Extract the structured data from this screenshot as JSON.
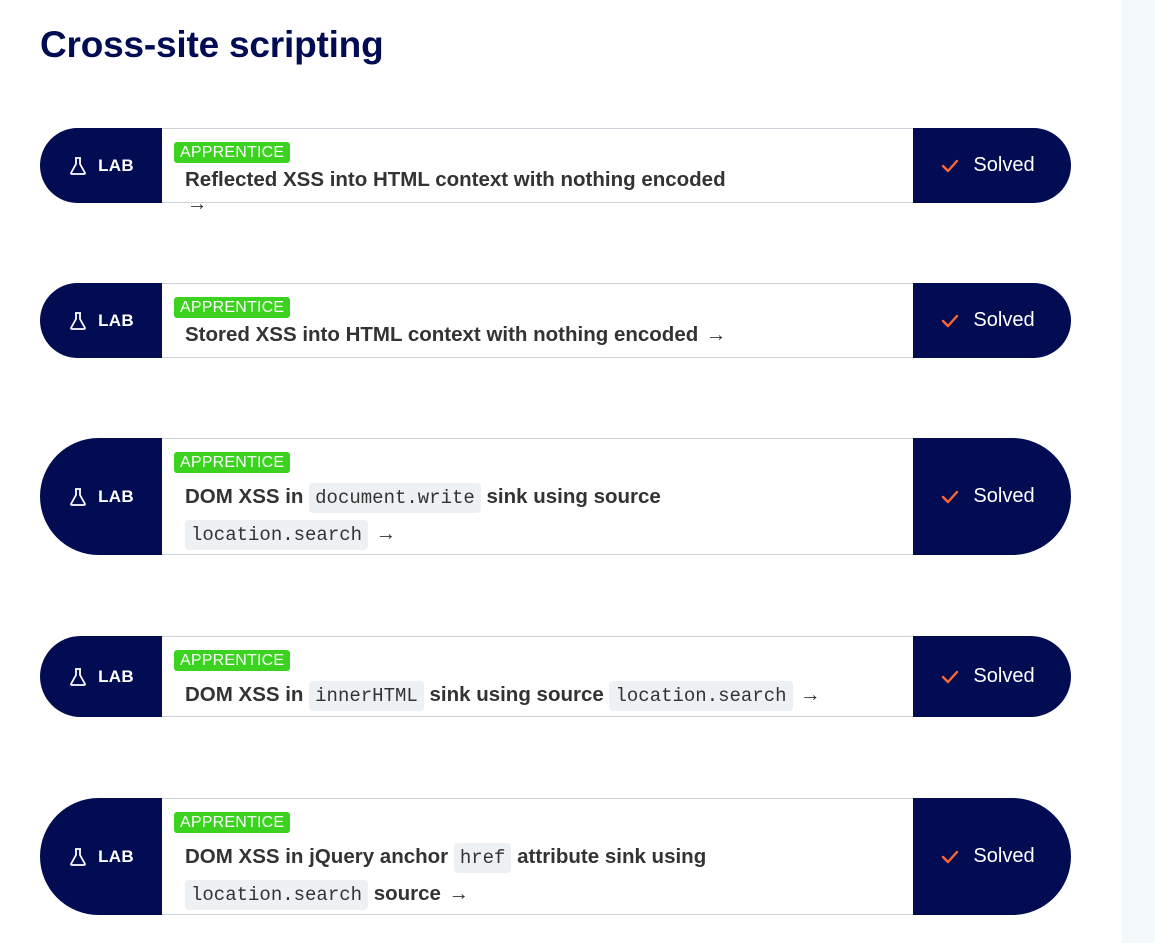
{
  "page": {
    "title": "Cross-site scripting"
  },
  "labs": [
    {
      "badge": "LAB",
      "level": "APPRENTICE",
      "title_parts": [
        {
          "t": "text",
          "v": "Reflected XSS into HTML context with nothing encoded"
        }
      ],
      "arrow": "→",
      "status": "Solved"
    },
    {
      "badge": "LAB",
      "level": "APPRENTICE",
      "title_parts": [
        {
          "t": "text",
          "v": "Stored XSS into HTML context with nothing encoded"
        }
      ],
      "arrow": "→",
      "status": "Solved"
    },
    {
      "badge": "LAB",
      "level": "APPRENTICE",
      "title_parts": [
        {
          "t": "text",
          "v": "DOM XSS in "
        },
        {
          "t": "code",
          "v": "document.write"
        },
        {
          "t": "text",
          "v": " sink using source "
        },
        {
          "t": "code",
          "v": "location.search"
        }
      ],
      "arrow": "→",
      "status": "Solved"
    },
    {
      "badge": "LAB",
      "level": "APPRENTICE",
      "title_parts": [
        {
          "t": "text",
          "v": "DOM XSS in "
        },
        {
          "t": "code",
          "v": "innerHTML"
        },
        {
          "t": "text",
          "v": " sink using source "
        },
        {
          "t": "code",
          "v": "location.search"
        }
      ],
      "arrow": "→",
      "status": "Solved"
    },
    {
      "badge": "LAB",
      "level": "APPRENTICE",
      "title_parts": [
        {
          "t": "text",
          "v": "DOM XSS in jQuery anchor "
        },
        {
          "t": "code",
          "v": "href"
        },
        {
          "t": "text",
          "v": " attribute sink using "
        },
        {
          "t": "code",
          "v": "location.search"
        },
        {
          "t": "text",
          "v": " source"
        }
      ],
      "arrow": "→",
      "status": "Solved"
    }
  ],
  "icons": {
    "badge_icon": "flask-icon",
    "status_icon": "checkmark-icon"
  },
  "colors": {
    "navy": "#010c53",
    "apprentice_green": "#3bd320",
    "check_orange": "#ff6633"
  }
}
